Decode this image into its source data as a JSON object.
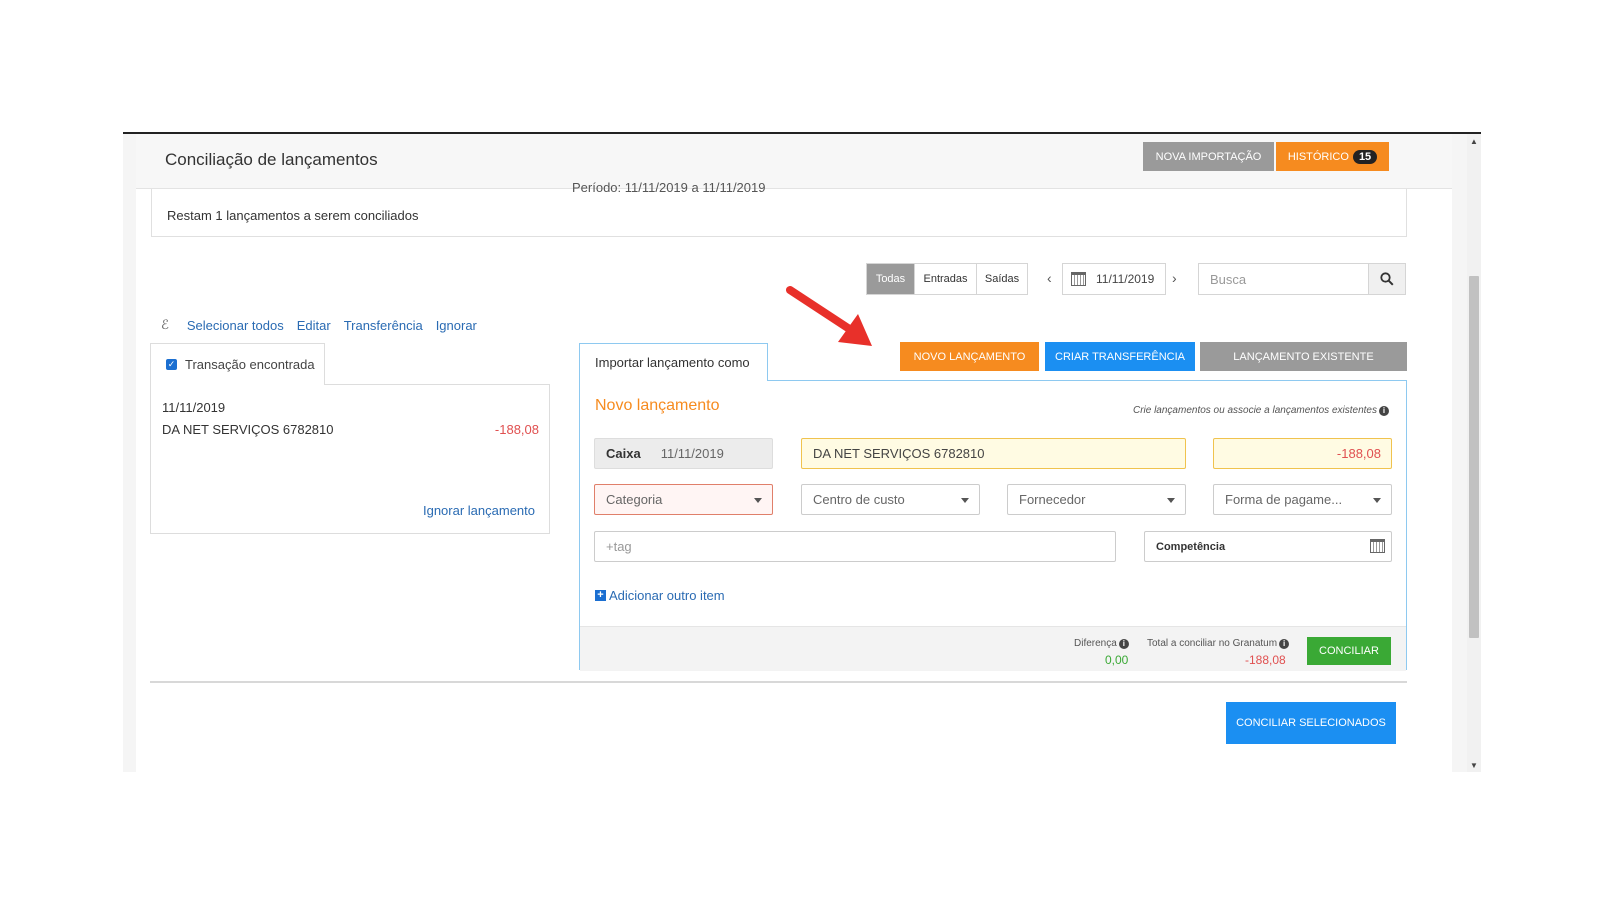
{
  "header": {
    "title": "Conciliação de lançamentos",
    "nova_importacao": "NOVA IMPORTAÇÃO",
    "historico": "HISTÓRICO",
    "historico_count": "15"
  },
  "summary": {
    "periodo": "Período: 11/11/2019 a 11/11/2019",
    "restam": "Restam 1 lançamentos a serem conciliados"
  },
  "filters": {
    "tabs": [
      "Todas",
      "Entradas",
      "Saídas"
    ],
    "active_tab": "Todas",
    "date": "11/11/2019",
    "search_placeholder": "Busca"
  },
  "actions": {
    "pin": "ℰ",
    "selecionar_todos": "Selecionar todos",
    "editar": "Editar",
    "transferencia": "Transferência",
    "ignorar": "Ignorar"
  },
  "transaction": {
    "tab_label": "Transação encontrada",
    "checked": true,
    "date": "11/11/2019",
    "description": "DA NET SERVIÇOS 6782810",
    "amount": "-188,08",
    "ignore_link": "Ignorar lançamento"
  },
  "import": {
    "tab_label": "Importar lançamento como",
    "novo_lancamento_btn": "NOVO LANÇAMENTO",
    "criar_transferencia_btn": "CRIAR TRANSFERÊNCIA",
    "lancamento_existente_btn": "LANÇAMENTO EXISTENTE",
    "panel_title": "Novo lançamento",
    "hint": "Crie lançamentos ou associe a lançamentos existentes",
    "account": "Caixa",
    "date": "11/11/2019",
    "description": "DA  NET SERVIÇOS 6782810",
    "value": "-188,08",
    "categoria": "Categoria",
    "centro_de_custo": "Centro de custo",
    "fornecedor": "Fornecedor",
    "forma_pagamento": "Forma de pagame...",
    "tag_placeholder": "+tag",
    "competencia": "Competência",
    "add_item": "Adicionar outro item",
    "diferenca_label": "Diferença",
    "diferenca_value": "0,00",
    "total_label": "Total a conciliar no Granatum",
    "total_value": "-188,08",
    "conciliar_btn": "CONCILIAR"
  },
  "bottom": {
    "conciliar_selecionados": "CONCILIAR SELECIONADOS"
  },
  "colors": {
    "orange": "#f68b1f",
    "blue": "#1b8ff2",
    "gray_button": "#9a9a9a",
    "green": "#3aa935",
    "negative": "#e05050",
    "arrow": "#e8302a"
  }
}
